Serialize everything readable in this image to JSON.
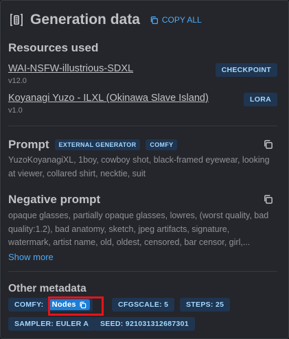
{
  "header": {
    "title": "Generation data",
    "copy_all": "COPY ALL"
  },
  "resources": {
    "title": "Resources used",
    "items": [
      {
        "name": "WAI-NSFW-illustrious-SDXL",
        "version": "v12.0",
        "type": "CHECKPOINT"
      },
      {
        "name": "Koyanagi Yuzo - ILXL (Okinawa Slave Island)",
        "version": "v1.0",
        "type": "LORA"
      }
    ]
  },
  "prompt": {
    "title": "Prompt",
    "tags": [
      "EXTERNAL GENERATOR",
      "COMFY"
    ],
    "text": "YuzoKoyanagiXL, 1boy, cowboy shot, black-framed eyewear, looking at viewer, collared shirt, necktie, suit"
  },
  "negative_prompt": {
    "title": "Negative prompt",
    "text": "opaque glasses, partially opaque glasses, lowres, (worst quality, bad quality:1.2), bad anatomy, sketch, jpeg artifacts, signature, watermark, artist name, old, oldest, censored, bar censor, girl,...",
    "show_more": "Show more"
  },
  "metadata": {
    "title": "Other metadata",
    "comfy_label": "COMFY:",
    "nodes_label": "Nodes",
    "cfg": "CFGSCALE: 5",
    "steps": "STEPS: 25",
    "sampler": "SAMPLER: EULER A",
    "seed": "SEED: 921031312687301"
  }
}
